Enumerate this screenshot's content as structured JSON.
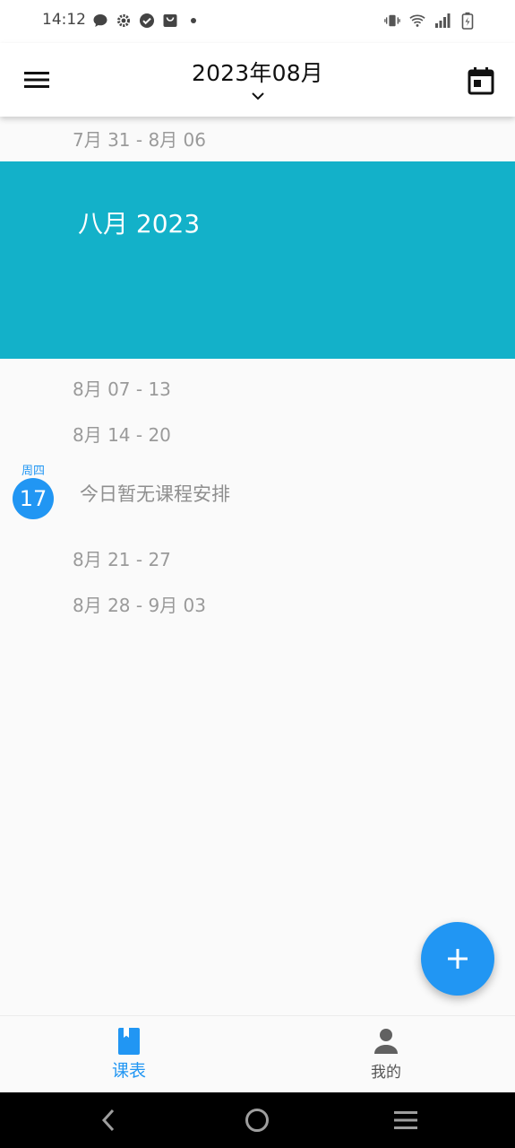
{
  "status_bar": {
    "time": "14:12",
    "left_icons": [
      "message-icon",
      "settings-gear-icon",
      "check-circle-icon",
      "shopping-bag-icon",
      "dot-icon"
    ],
    "right_icons": [
      "vibrate-icon",
      "wifi-icon",
      "signal-icon",
      "battery-charging-icon"
    ]
  },
  "app_bar": {
    "title": "2023年08月",
    "menu_icon": "hamburger-menu-icon",
    "calendar_icon": "calendar-today-icon",
    "chevron_icon": "chevron-down-icon"
  },
  "weeks": {
    "w1": "7月 31 - 8月 06",
    "w2": "8月 07 - 13",
    "w3": "8月 14 - 20",
    "w4": "8月 21 - 27",
    "w5": "8月 28 - 9月 03"
  },
  "month_banner": {
    "title": "八月 2023",
    "color": "#13b1c9"
  },
  "today": {
    "weekday": "周四",
    "date": "17",
    "message": "今日暂无课程安排"
  },
  "fab": {
    "icon": "plus-icon"
  },
  "bottom_nav": {
    "schedule_label": "课表",
    "mine_label": "我的",
    "schedule_icon": "book-icon",
    "mine_icon": "person-icon"
  },
  "system_nav": {
    "back_icon": "back-chevron-icon",
    "home_icon": "home-circle-icon",
    "recents_icon": "menu-lines-icon"
  },
  "colors": {
    "accent": "#2196f3",
    "muted_text": "#9a9a9a"
  }
}
